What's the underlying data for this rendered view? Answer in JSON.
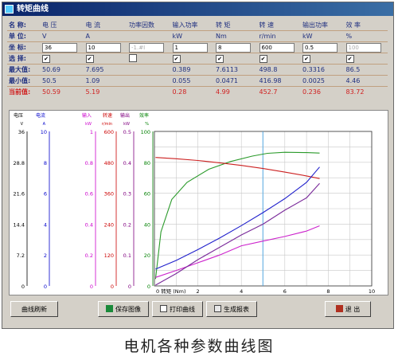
{
  "window": {
    "title": "转矩曲线"
  },
  "headers": [
    "名 称:",
    "电 压",
    "电 流",
    "功率因数",
    "输入功率",
    "转 矩",
    "转 速",
    "输出功率",
    "效 率"
  ],
  "units": [
    "单 位:",
    "V",
    "A",
    "",
    "kW",
    "Nm",
    "r/min",
    "kW",
    "%"
  ],
  "coords": {
    "label": "坐 标:",
    "values": [
      "36",
      "10",
      "-1.#I",
      "1",
      "8",
      "600",
      "0.5",
      "100"
    ]
  },
  "select": {
    "label": "选 择:",
    "checked": [
      true,
      true,
      false,
      true,
      true,
      true,
      true,
      true
    ]
  },
  "max": {
    "label": "最大值:",
    "values": [
      "50.69",
      "7.695",
      "",
      "0.389",
      "7.6113",
      "498.8",
      "0.3316",
      "86.5"
    ]
  },
  "min": {
    "label": "最小值:",
    "values": [
      "50.5",
      "1.09",
      "",
      "0.055",
      "0.0471",
      "416.98",
      "0.0025",
      "4.46"
    ]
  },
  "current": {
    "label": "当前值:",
    "values": [
      "50.59",
      "5.19",
      "",
      "0.28",
      "4.99",
      "452.7",
      "0.236",
      "83.72"
    ]
  },
  "buttons": {
    "clear": "曲线刷新",
    "save": "保存图像",
    "print": "打印曲线",
    "report": "生成报表",
    "exit": "退 出"
  },
  "caption": "电机各种参数曲线图",
  "chart_data": {
    "type": "line",
    "x_axis": {
      "label": "转矩 (Nm)",
      "range": [
        0,
        10
      ],
      "ticks": [
        "0",
        "2",
        "4",
        "6",
        "8",
        "10"
      ]
    },
    "axes": [
      {
        "name": "电压",
        "unit": "V",
        "ticks": [
          "36",
          "28.8",
          "21.6",
          "14.4",
          "7.2",
          "0"
        ],
        "color": "#000000"
      },
      {
        "name": "电流",
        "unit": "A",
        "ticks": [
          "10",
          "8",
          "6",
          "4",
          "2",
          "0"
        ],
        "color": "#0000cc"
      },
      {
        "name": "输入",
        "unit": "kW",
        "ticks": [
          "1",
          "0.8",
          "0.6",
          "0.4",
          "0.2",
          "0"
        ],
        "color": "#cc00cc"
      },
      {
        "name": "转速",
        "unit": "r/min",
        "ticks": [
          "600",
          "480",
          "360",
          "240",
          "120",
          "0"
        ],
        "color": "#cc0000"
      },
      {
        "name": "输出",
        "unit": "kW",
        "ticks": [
          "0.5",
          "0.4",
          "0.3",
          "0.2",
          "0.1",
          "0"
        ],
        "color": "#800080"
      },
      {
        "name": "效率",
        "unit": "%",
        "ticks": [
          "100",
          "80",
          "60",
          "40",
          "20",
          "0"
        ],
        "color": "#008000"
      }
    ],
    "grid": true,
    "cursor_x": 4.99,
    "series": [
      {
        "name": "效率",
        "color": "#2a9a2a",
        "x": [
          0.05,
          0.3,
          0.8,
          1.5,
          2.5,
          3.5,
          4.5,
          5.2,
          6,
          7,
          7.6
        ],
        "y": [
          4.5,
          35,
          56,
          67,
          75.5,
          80.5,
          84,
          85.8,
          86.5,
          86.3,
          86
        ]
      },
      {
        "name": "转速",
        "color": "#cc2020",
        "x": [
          0.05,
          1,
          2,
          3,
          4,
          5,
          6,
          7,
          7.6
        ],
        "y": [
          498.8,
          494,
          487,
          478,
          468,
          456,
          442,
          427,
          417
        ]
      },
      {
        "name": "电流",
        "color": "#2020cc",
        "x": [
          0.05,
          1,
          2,
          3,
          4,
          5,
          6,
          7,
          7.6
        ],
        "y": [
          1.09,
          1.65,
          2.35,
          3.1,
          3.9,
          4.75,
          5.65,
          6.7,
          7.695
        ]
      },
      {
        "name": "输入",
        "color": "#cc22cc",
        "x": [
          0.05,
          1,
          2,
          3,
          4,
          5,
          6,
          7,
          7.6
        ],
        "y": [
          0.055,
          0.1,
          0.15,
          0.2,
          0.26,
          0.29,
          0.32,
          0.355,
          0.389
        ]
      },
      {
        "name": "输出",
        "color": "#7a2a9a",
        "x": [
          0.05,
          1,
          2,
          3,
          4,
          5,
          6,
          7,
          7.6
        ],
        "y": [
          0.0025,
          0.04,
          0.085,
          0.125,
          0.165,
          0.2,
          0.245,
          0.285,
          0.3316
        ]
      }
    ]
  }
}
